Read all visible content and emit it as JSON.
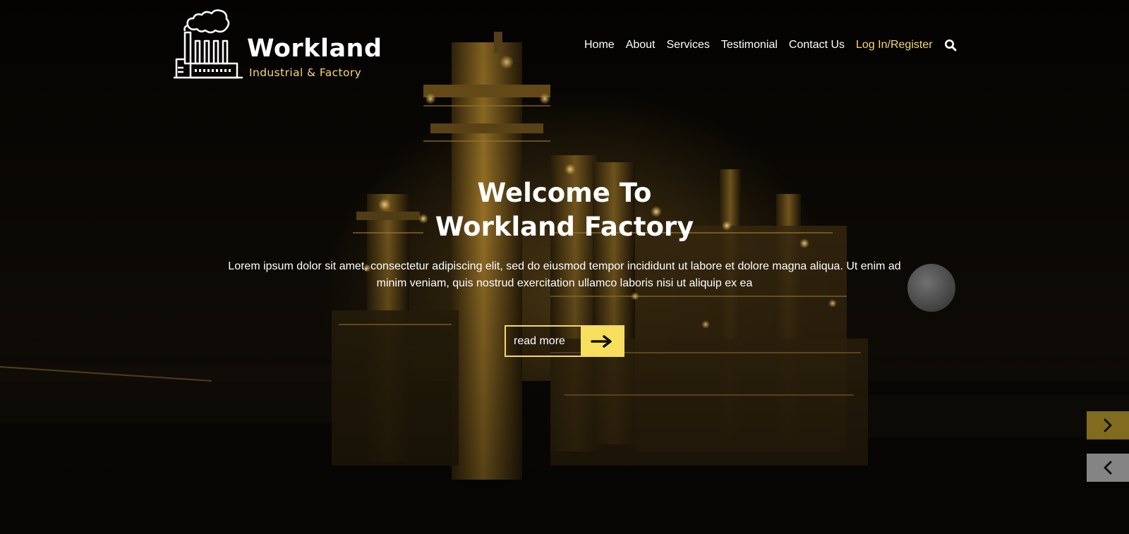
{
  "brand": {
    "name": "Workland",
    "tagline": "Industrial & Factory",
    "accent_color": "#f5d96b"
  },
  "nav": {
    "items": [
      "Home",
      "About",
      "Services",
      "Testimonial",
      "Contact Us"
    ],
    "login_label": "Log In/Register",
    "search_icon": "search-icon"
  },
  "hero": {
    "title_line1": "Welcome To",
    "title_line2": "Workland Factory",
    "description": "Lorem ipsum dolor sit amet, consectetur adipiscing elit, sed do eiusmod tempor incididunt ut labore et dolore magna aliqua. Ut enim ad minim veniam, quis nostrud exercitation ullamco laboris nisi ut aliquip ex ea",
    "button_label": "read more",
    "button_icon": "arrow-right-icon",
    "button_color": "#f7df5e"
  },
  "slider": {
    "next_icon": "chevron-right-icon",
    "prev_icon": "chevron-left-icon"
  }
}
